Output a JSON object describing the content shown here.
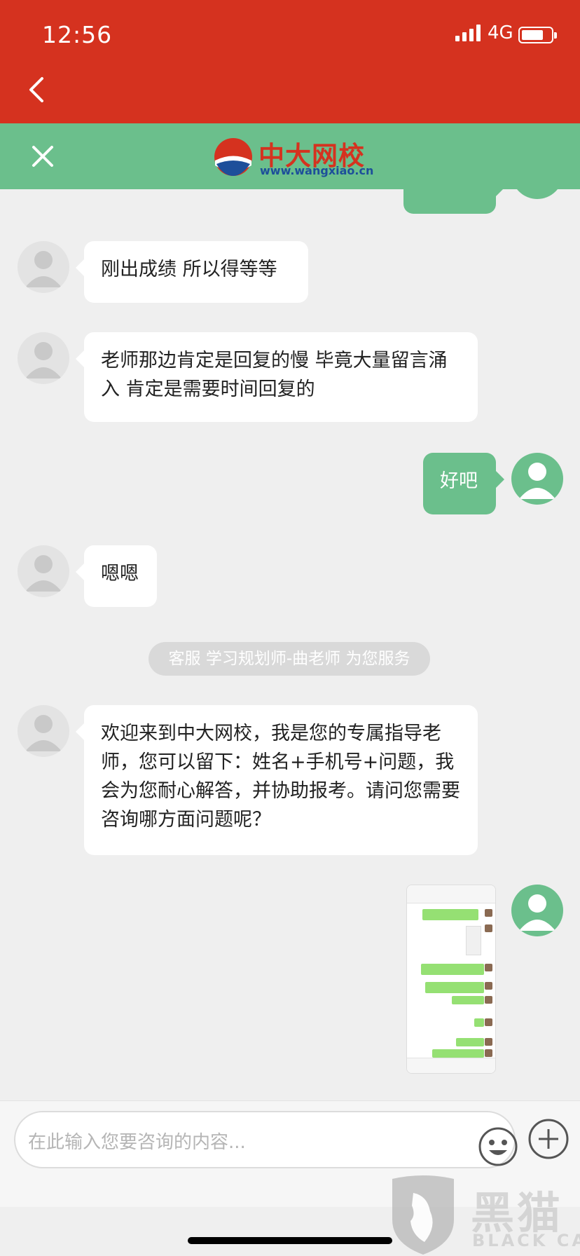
{
  "status_bar": {
    "time": "12:56",
    "network": "4G"
  },
  "brand": {
    "name_cn": "中大网校",
    "url": "www.wangxiao.cn"
  },
  "messages": [
    {
      "side": "left",
      "text": "刚出成绩  所以得等等"
    },
    {
      "side": "left",
      "text": "老师那边肯定是回复的慢  毕竟大量留言涌入   肯定是需要时间回复的"
    },
    {
      "side": "right",
      "text": "好吧"
    },
    {
      "side": "left",
      "text": "嗯嗯"
    },
    {
      "side": "left",
      "text": "欢迎来到中大网校，我是您的专属指导老师，您可以留下：姓名+手机号+问题，我会为您耐心解答，并协助报考。请问您需要咨询哪方面问题呢？"
    }
  ],
  "system_notice": "客服 学习规划师-曲老师 为您服务",
  "input": {
    "placeholder": "在此输入您要咨询的内容..."
  },
  "watermark": {
    "cn": "黑猫",
    "en": "BLACK CAT"
  },
  "colors": {
    "top_bar": "#d5321f",
    "brand_green": "#6bbf8c",
    "background": "#efefef"
  },
  "icons": [
    "back-arrow-icon",
    "close-icon",
    "emoji-icon",
    "plus-icon"
  ]
}
